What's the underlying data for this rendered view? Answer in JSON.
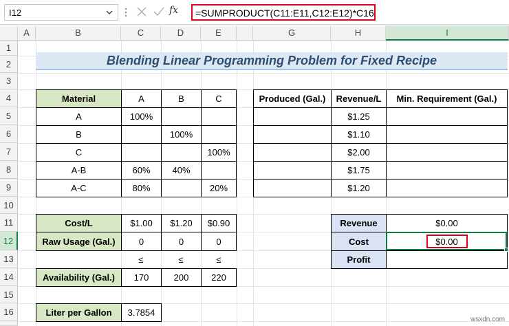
{
  "formula_bar": {
    "name_box": "I12",
    "formula": "=SUMPRODUCT(C11:E11,C12:E12)*C16",
    "fx": "fx"
  },
  "columns": [
    "A",
    "B",
    "C",
    "D",
    "E",
    "G",
    "H",
    "I"
  ],
  "rows": [
    "1",
    "2",
    "3",
    "4",
    "5",
    "6",
    "7",
    "8",
    "9",
    "10",
    "11",
    "12",
    "13",
    "14",
    "15",
    "16",
    "17"
  ],
  "title": "Blending Linear Programming Problem for Fixed Recipe",
  "material_table": {
    "headers": [
      "Material",
      "A",
      "B",
      "C"
    ],
    "rows": [
      [
        "A",
        "100%",
        "",
        ""
      ],
      [
        "B",
        "",
        "100%",
        ""
      ],
      [
        "C",
        "",
        "",
        "100%"
      ],
      [
        "A-B",
        "60%",
        "40%",
        ""
      ],
      [
        "A-C",
        "80%",
        "",
        "20%"
      ]
    ]
  },
  "production_table": {
    "headers": [
      "Produced (Gal.)",
      "Revenue/L",
      "Min. Requirement (Gal.)"
    ],
    "rows": [
      [
        "",
        "$1.25",
        ""
      ],
      [
        "",
        "$1.10",
        ""
      ],
      [
        "",
        "$2.00",
        ""
      ],
      [
        "",
        "$1.75",
        ""
      ],
      [
        "",
        "$1.20",
        ""
      ]
    ]
  },
  "cost_table": {
    "cost_label": "Cost/L",
    "costs": [
      "$1.00",
      "$1.20",
      "$0.90"
    ],
    "usage_label": "Raw Usage (Gal.)",
    "usage": [
      "0",
      "0",
      "0"
    ],
    "leq": [
      "≤",
      "≤",
      "≤"
    ],
    "avail_label": "Availability (Gal.)",
    "availability": [
      "170",
      "200",
      "220"
    ]
  },
  "summary": {
    "revenue_label": "Revenue",
    "revenue": "$0.00",
    "cost_label": "Cost",
    "cost": "$0.00",
    "profit_label": "Profit",
    "profit": ""
  },
  "liter_per_gallon": {
    "label": "Liter per Gallon",
    "value": "3.7854"
  },
  "watermark": "wsxdn.com",
  "colors": {
    "green_header": "#d9e8c4",
    "blue_header": "#dae3f3",
    "title_bg": "#dce9f5",
    "highlight_red": "#e0001a",
    "excel_green": "#107c41"
  }
}
